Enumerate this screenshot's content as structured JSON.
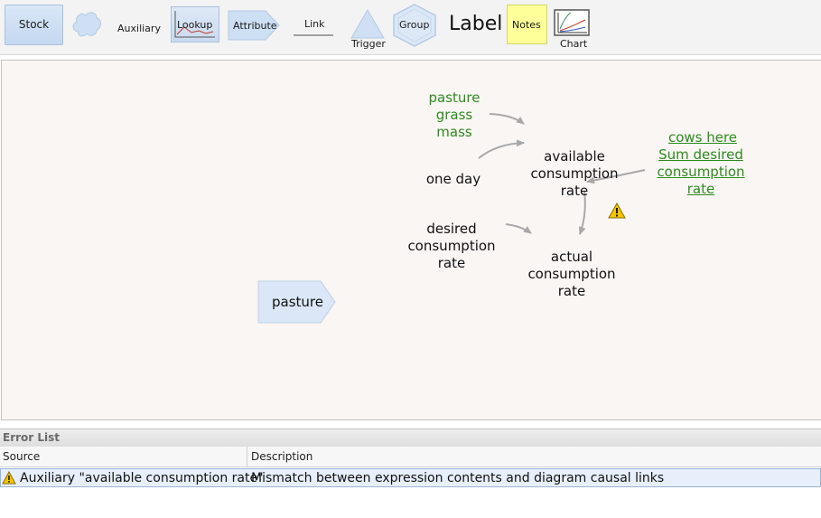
{
  "toolbar": {
    "stock": "Stock",
    "auxiliary": "Auxiliary",
    "lookup": "Lookup",
    "attribute": "Attribute",
    "link": "Link",
    "trigger": "Trigger",
    "group": "Group",
    "label": "Label",
    "notes": "Notes",
    "chart": "Chart",
    "colors": {
      "stock_fill": "#c9daf0",
      "notes_fill": "#ffff99"
    }
  },
  "diagram": {
    "stock_pasture": "pasture",
    "ghost_pasture_grass_mass": "pasture\ngrass\nmass",
    "one_day": "one day",
    "available_consumption_rate": "available\nconsumption\nrate",
    "ghost_cows_here": "cows here",
    "ghost_sum_desired": "Sum desired\nconsumption\nrate",
    "desired_consumption_rate": "desired\nconsumption\nrate",
    "actual_consumption_rate": "actual\nconsumption\nrate",
    "warning_icon": "warning-icon",
    "colors": {
      "ghost_text": "#2e8b20",
      "link_arrow": "#a8a8a8",
      "canvas_bg": "#faf6f4"
    }
  },
  "error_list": {
    "title": "Error List",
    "columns": [
      "Source",
      "Description"
    ],
    "rows": [
      {
        "icon": "warning-icon",
        "source": "Auxiliary \"available consumption rate\"",
        "description": "Mismatch between expression contents and diagram causal links"
      }
    ]
  }
}
